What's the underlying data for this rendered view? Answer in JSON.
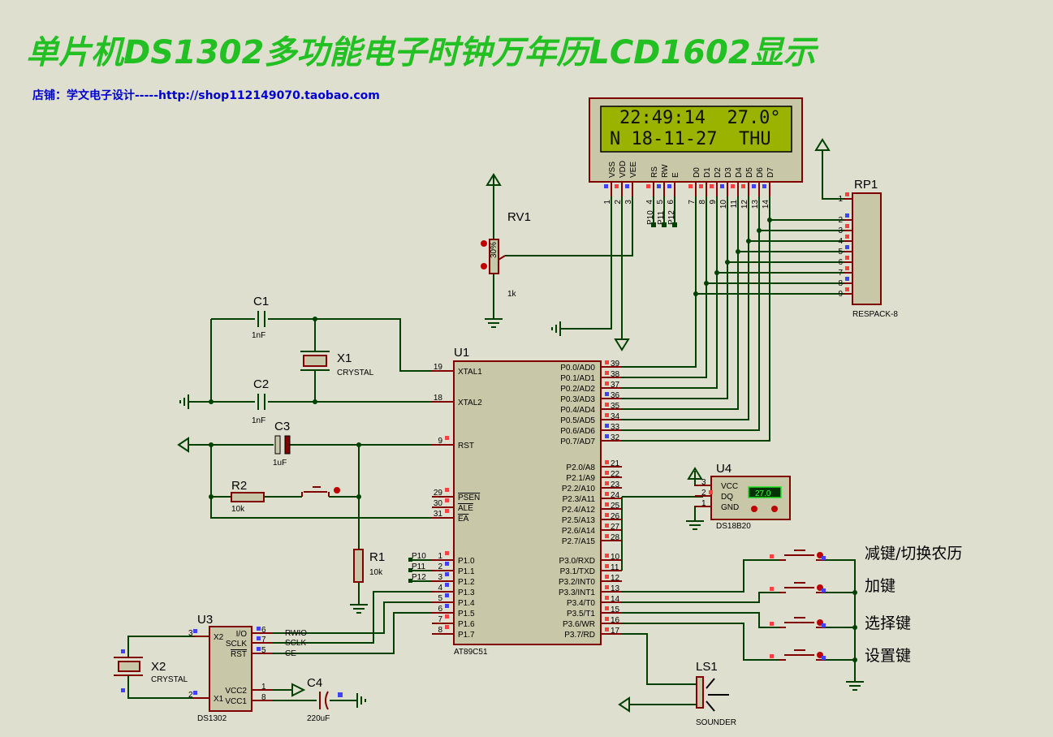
{
  "title": "单片机DS1302多功能电子时钟万年历LCD1602显示",
  "subtitle": "店铺：学文电子设计-----http://shop112149070.taobao.com",
  "colors": {
    "wire": "#004000",
    "pin": "#800000",
    "body": "#c8c8a8",
    "lcd_screen": "#99b300",
    "title": "#22c022",
    "subtitle": "#0000d0",
    "pin_high": "#ff4040",
    "pin_low": "#4040ff"
  },
  "lcd": {
    "line1": "22:49:14  27.0°",
    "line2": "N 18-11-27  THU",
    "pins": [
      {
        "num": "1",
        "label": "VSS"
      },
      {
        "num": "2",
        "label": "VDD"
      },
      {
        "num": "3",
        "label": "VEE"
      },
      {
        "num": "4",
        "label": "RS"
      },
      {
        "num": "5",
        "label": "RW"
      },
      {
        "num": "6",
        "label": "E"
      },
      {
        "num": "7",
        "label": "D0"
      },
      {
        "num": "8",
        "label": "D1"
      },
      {
        "num": "9",
        "label": "D2"
      },
      {
        "num": "10",
        "label": "D3"
      },
      {
        "num": "11",
        "label": "D4"
      },
      {
        "num": "12",
        "label": "D5"
      },
      {
        "num": "13",
        "label": "D6"
      },
      {
        "num": "14",
        "label": "D7"
      }
    ],
    "net_labels": [
      "P10",
      "P11",
      "P12"
    ]
  },
  "rp1": {
    "ref": "RP1",
    "value": "RESPACK-8",
    "pins": [
      "1",
      "2",
      "3",
      "4",
      "5",
      "6",
      "7",
      "8",
      "9"
    ]
  },
  "rv1": {
    "ref": "RV1",
    "value": "1k",
    "wiper": "30%"
  },
  "c1": {
    "ref": "C1",
    "value": "1nF"
  },
  "c2": {
    "ref": "C2",
    "value": "1nF"
  },
  "c3": {
    "ref": "C3",
    "value": "1uF"
  },
  "c4": {
    "ref": "C4",
    "value": "220uF"
  },
  "x1": {
    "ref": "X1",
    "value": "CRYSTAL"
  },
  "x2": {
    "ref": "X2",
    "value": "CRYSTAL"
  },
  "r1": {
    "ref": "R1",
    "value": "10k"
  },
  "r2": {
    "ref": "R2",
    "value": "10k"
  },
  "u1": {
    "ref": "U1",
    "part": "AT89C51",
    "left_pins": [
      {
        "num": "19",
        "label": "XTAL1"
      },
      {
        "num": "18",
        "label": "XTAL2"
      },
      {
        "num": "9",
        "label": "RST"
      },
      {
        "num": "29",
        "label": "PSEN"
      },
      {
        "num": "30",
        "label": "ALE"
      },
      {
        "num": "31",
        "label": "EA"
      },
      {
        "num": "1",
        "label": "P1.0"
      },
      {
        "num": "2",
        "label": "P1.1"
      },
      {
        "num": "3",
        "label": "P1.2"
      },
      {
        "num": "4",
        "label": "P1.3"
      },
      {
        "num": "5",
        "label": "P1.4"
      },
      {
        "num": "6",
        "label": "P1.5"
      },
      {
        "num": "7",
        "label": "P1.6"
      },
      {
        "num": "8",
        "label": "P1.7"
      }
    ],
    "right_pins": [
      {
        "num": "39",
        "label": "P0.0/AD0"
      },
      {
        "num": "38",
        "label": "P0.1/AD1"
      },
      {
        "num": "37",
        "label": "P0.2/AD2"
      },
      {
        "num": "36",
        "label": "P0.3/AD3"
      },
      {
        "num": "35",
        "label": "P0.4/AD4"
      },
      {
        "num": "34",
        "label": "P0.5/AD5"
      },
      {
        "num": "33",
        "label": "P0.6/AD6"
      },
      {
        "num": "32",
        "label": "P0.7/AD7"
      },
      {
        "num": "21",
        "label": "P2.0/A8"
      },
      {
        "num": "22",
        "label": "P2.1/A9"
      },
      {
        "num": "23",
        "label": "P2.2/A10"
      },
      {
        "num": "24",
        "label": "P2.3/A11"
      },
      {
        "num": "25",
        "label": "P2.4/A12"
      },
      {
        "num": "26",
        "label": "P2.5/A13"
      },
      {
        "num": "27",
        "label": "P2.6/A14"
      },
      {
        "num": "28",
        "label": "P2.7/A15"
      },
      {
        "num": "10",
        "label": "P3.0/RXD"
      },
      {
        "num": "11",
        "label": "P3.1/TXD"
      },
      {
        "num": "12",
        "label": "P3.2/INT0"
      },
      {
        "num": "13",
        "label": "P3.3/INT1"
      },
      {
        "num": "14",
        "label": "P3.4/T0"
      },
      {
        "num": "15",
        "label": "P3.5/T1"
      },
      {
        "num": "16",
        "label": "P3.6/WR"
      },
      {
        "num": "17",
        "label": "P3.7/RD"
      }
    ],
    "p1_net_labels": [
      "P10",
      "P11",
      "P12"
    ]
  },
  "u3": {
    "ref": "U3",
    "part": "DS1302",
    "pins": [
      {
        "num": "3",
        "label": "X2"
      },
      {
        "num": "2",
        "label": "X1"
      },
      {
        "num": "6",
        "label": "I/O"
      },
      {
        "num": "7",
        "label": "SCLK"
      },
      {
        "num": "5",
        "label": "RST"
      },
      {
        "num": "1",
        "label": "VCC2"
      },
      {
        "num": "8",
        "label": "VCC1"
      }
    ],
    "nets": [
      "RWIO",
      "SCLK",
      "CE"
    ]
  },
  "u4": {
    "ref": "U4",
    "part": "DS18B20",
    "reading": "27.0",
    "pins": [
      {
        "num": "3",
        "label": "VCC"
      },
      {
        "num": "2",
        "label": "DQ"
      },
      {
        "num": "1",
        "label": "GND"
      }
    ]
  },
  "ls1": {
    "ref": "LS1",
    "value": "SOUNDER"
  },
  "buttons": [
    {
      "label": "减键/切换农历"
    },
    {
      "label": "加键"
    },
    {
      "label": "选择键"
    },
    {
      "label": "设置键"
    }
  ]
}
